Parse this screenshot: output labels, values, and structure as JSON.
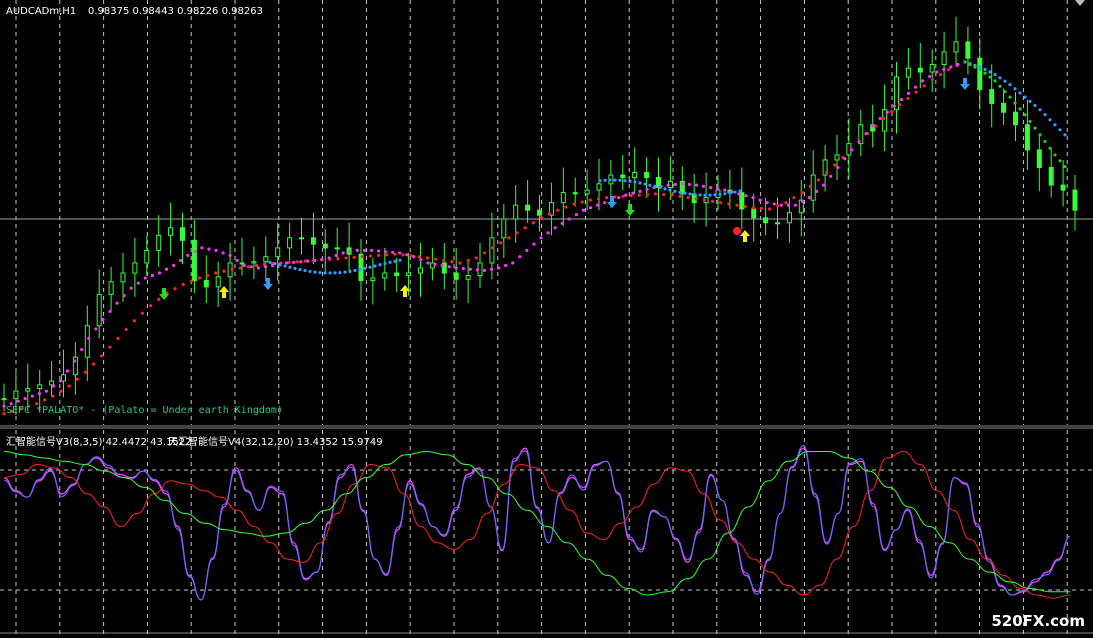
{
  "header": {
    "symbol": "AUDCADm,H1",
    "ohlc": "0.98375 0.98443 0.98226 0.98263"
  },
  "overlay_text": "SEPC *PALATO* - (Palato = Under earth Kingdom)",
  "indicator": {
    "title_1": "汇智能信号V3(8,3,5) 42.4472 43.1522",
    "title_2": "天汇智能信号V4(32,12,20) 13.4352 15.9749"
  },
  "watermark": "520FX.com",
  "colors": {
    "background": "#000000",
    "bull_candle": "#33ff33",
    "ma_fast": "#ff33ff",
    "ma_slow": "#ff2222",
    "ma_blue": "#3399ff",
    "ma_green": "#22cc22",
    "arrow_up": "#ffee00",
    "arrow_down_green": "#22dd22",
    "arrow_down_blue": "#3399ff",
    "osc_blue": "#6666ff",
    "osc_magenta": "#ff44ff",
    "osc_red": "#ff2222",
    "osc_green": "#33ff33",
    "grid": "#c8c8c8"
  },
  "chart_data": [
    {
      "type": "line",
      "title": "AUDCADm,H1",
      "series": [
        {
          "values": [
            0.9682,
            0.9688,
            0.969,
            0.9693,
            0.9696,
            0.9701,
            0.9715,
            0.974,
            0.9765,
            0.9775,
            0.9782,
            0.979,
            0.98,
            0.9812,
            0.9818,
            0.9808,
            0.9776,
            0.9771,
            0.9779,
            0.979,
            0.979,
            0.9791,
            0.9795,
            0.9802,
            0.981,
            0.981,
            0.9805,
            0.9802,
            0.9802,
            0.9797,
            0.9776,
            0.9778,
            0.9782,
            0.978,
            0.9782,
            0.9786,
            0.979,
            0.9782,
            0.9777,
            0.978,
            0.979,
            0.981,
            0.9825,
            0.9836,
            0.9832,
            0.9828,
            0.9838,
            0.9846,
            0.9845,
            0.9848,
            0.9853,
            0.986,
            0.9858,
            0.9862,
            0.9858,
            0.985,
            0.9855,
            0.9845,
            0.9838,
            0.9842,
            0.9848,
            0.9846,
            0.9833,
            0.9826,
            0.9822,
            0.9822,
            0.983,
            0.984,
            0.986,
            0.9872,
            0.9876,
            0.9885,
            0.99,
            0.9895,
            0.9912,
            0.9938,
            0.9945,
            0.9942,
            0.9948,
            0.9958,
            0.9966,
            0.9953,
            0.9928,
            0.9917,
            0.991,
            0.99,
            0.988,
            0.9866,
            0.9852,
            0.9848,
            0.9832
          ]
        },
        {
          "name": "ma_fast",
          "values": [
            0.9676,
            0.968,
            0.9684,
            0.9688,
            0.9696,
            0.9712,
            0.973,
            0.9745,
            0.9758,
            0.977,
            0.9778,
            0.9782,
            0.9788,
            0.9796,
            0.9802,
            0.98,
            0.9796,
            0.9788,
            0.9786,
            0.9788,
            0.979,
            0.9791,
            0.9792,
            0.9794,
            0.9798,
            0.98,
            0.98,
            0.9799,
            0.9798,
            0.9795,
            0.979,
            0.9788,
            0.9786,
            0.9785,
            0.9784,
            0.9786,
            0.979,
            0.98,
            0.981,
            0.9818,
            0.9825,
            0.9832,
            0.9836,
            0.984,
            0.9844,
            0.9847,
            0.985,
            0.9852,
            0.9853,
            0.9852,
            0.985,
            0.9848,
            0.9845,
            0.9842,
            0.9838,
            0.9836,
            0.9836,
            0.9842,
            0.9852,
            0.9866,
            0.988,
            0.9893,
            0.9905,
            0.9915,
            0.9925,
            0.9935,
            0.9942,
            0.9946,
            0.995
          ]
        },
        {
          "name": "ma_slow",
          "values": [
            0.967,
            0.9674,
            0.9678,
            0.9684,
            0.9692,
            0.9703,
            0.9716,
            0.973,
            0.9744,
            0.9756,
            0.9766,
            0.9773,
            0.9778,
            0.9782,
            0.9785,
            0.9787,
            0.9789,
            0.979,
            0.9791,
            0.9792,
            0.9793,
            0.9794,
            0.9795,
            0.9796,
            0.9797,
            0.9796,
            0.9794,
            0.9792,
            0.979,
            0.9794,
            0.9802,
            0.981,
            0.9818,
            0.9826,
            0.9832,
            0.9837,
            0.984,
            0.9842,
            0.9843,
            0.9844,
            0.9845,
            0.9844,
            0.9842,
            0.984,
            0.9838,
            0.9836,
            0.9834,
            0.9833,
            0.9838,
            0.9846,
            0.9856,
            0.9868,
            0.988,
            0.9893,
            0.9905,
            0.9916,
            0.9926,
            0.9936,
            0.9944,
            0.995
          ]
        }
      ]
    },
    {
      "type": "line",
      "title": "汇智能信号V3(8,3,5) / 天汇智能信号V4(32,12,20)",
      "ylim": [
        0,
        100
      ],
      "series": [
        {
          "values": [
            80,
            72,
            68,
            78,
            84,
            70,
            76,
            88,
            92,
            86,
            82,
            80,
            84,
            78,
            70,
            50,
            20,
            5,
            30,
            62,
            86,
            72,
            60,
            74,
            70,
            40,
            18,
            22,
            52,
            80,
            88,
            60,
            30,
            20,
            48,
            78,
            64,
            50,
            44,
            60,
            82,
            86,
            62,
            35,
            90,
            98,
            62,
            40,
            70,
            80,
            74,
            88,
            90,
            70,
            42,
            36,
            60,
            56,
            42,
            28,
            48,
            82,
            66,
            42,
            20,
            10,
            30,
            58,
            86,
            98,
            70,
            40,
            58,
            88,
            90,
            64,
            36,
            48,
            60,
            40,
            20,
            40,
            80,
            76,
            50,
            30,
            14,
            8,
            10,
            16,
            22,
            30,
            44
          ]
        },
        {
          "values": [
            80,
            82,
            88,
            86,
            80,
            70,
            62,
            50,
            58,
            70,
            78,
            76,
            72,
            68,
            60,
            50,
            40,
            30,
            28,
            40,
            58,
            76,
            88,
            86,
            70,
            50,
            40,
            36,
            42,
            58,
            76,
            88,
            86,
            72,
            60,
            46,
            42,
            52,
            62,
            76,
            86,
            84,
            70,
            54,
            40,
            30,
            22,
            14,
            8,
            14,
            30,
            50,
            72,
            92,
            96,
            88,
            72,
            60,
            42,
            30,
            20,
            12,
            8,
            6,
            8
          ]
        },
        {
          "values": [
            96,
            94,
            92,
            90,
            88,
            84,
            80,
            74,
            66,
            58,
            52,
            48,
            46,
            44,
            46,
            52,
            60,
            70,
            80,
            88,
            94,
            96,
            94,
            88,
            80,
            70,
            60,
            50,
            40,
            30,
            20,
            12,
            8,
            10,
            18,
            30,
            46,
            62,
            78,
            90,
            96,
            96,
            92,
            84,
            74,
            62,
            50,
            40,
            30,
            22,
            16,
            12,
            10,
            10
          ]
        }
      ]
    }
  ]
}
